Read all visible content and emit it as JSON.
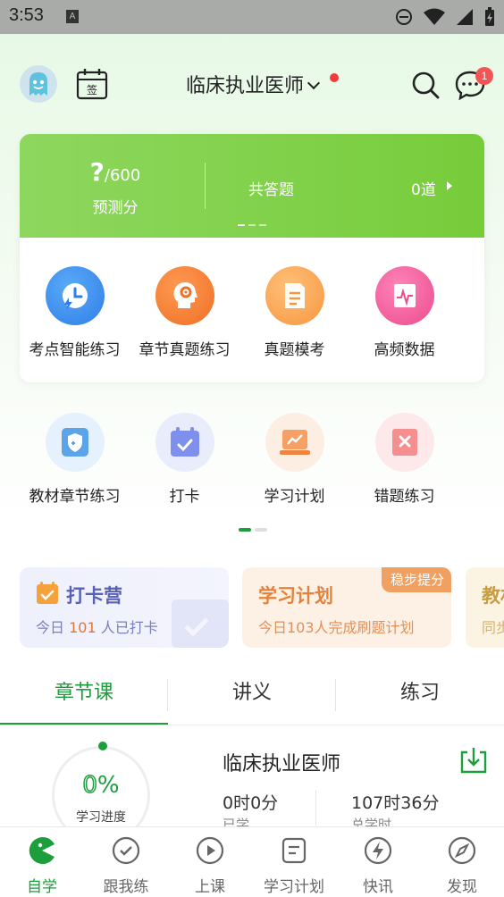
{
  "status_bar": {
    "time": "3:53",
    "notification_badge": "A"
  },
  "header": {
    "exam_title": "临床执业医师",
    "message_count": "1"
  },
  "score_card": {
    "score_value": "?",
    "score_total": "/600",
    "score_label": "预测分",
    "answered_label": "共答题",
    "answered_value": "0道"
  },
  "main_features": [
    {
      "label": "考点智能练习",
      "icon": "clock-bolt-icon",
      "color": "#3d8ef2"
    },
    {
      "label": "章节真题练习",
      "icon": "head-gear-icon",
      "color": "#f3823a"
    },
    {
      "label": "真题模考",
      "icon": "document-icon",
      "color": "#f9a45a"
    },
    {
      "label": "高频数据",
      "icon": "chart-board-icon",
      "color": "#f0609a"
    }
  ],
  "secondary_features": [
    {
      "label": "教材章节练习",
      "icon": "shield-book-icon"
    },
    {
      "label": "打卡",
      "icon": "calendar-check-icon"
    },
    {
      "label": "学习计划",
      "icon": "plan-chart-icon"
    },
    {
      "label": "错题练习",
      "icon": "wrong-answer-icon"
    }
  ],
  "promos": [
    {
      "title": "打卡营",
      "subtitle_pre": "今日",
      "subtitle_num": "101",
      "subtitle_post": "人已打卡"
    },
    {
      "title": "学习计划",
      "subtitle": "今日103人完成刷题计划",
      "tag": "稳步提分"
    },
    {
      "title": "教材",
      "subtitle": "同步"
    }
  ],
  "tabs": [
    "章节课",
    "讲义",
    "练习"
  ],
  "course": {
    "progress_value": "0",
    "progress_unit": "%",
    "progress_label": "学习进度",
    "title": "临床执业医师",
    "learned_time": "0时0分",
    "learned_label": "已学",
    "total_time": "107时36分",
    "total_label": "总学时"
  },
  "bottom_nav": [
    {
      "label": "自学",
      "icon": "self-study-icon",
      "active": true
    },
    {
      "label": "跟我练",
      "icon": "check-circle-icon",
      "active": false
    },
    {
      "label": "上课",
      "icon": "play-circle-icon",
      "active": false
    },
    {
      "label": "学习计划",
      "icon": "plan-doc-icon",
      "active": false
    },
    {
      "label": "快讯",
      "icon": "flash-icon",
      "active": false
    },
    {
      "label": "发现",
      "icon": "compass-icon",
      "active": false
    }
  ],
  "colors": {
    "brand_green": "#1d9e3c",
    "card_green": "#7ccf45",
    "badge_red": "#f25555"
  }
}
